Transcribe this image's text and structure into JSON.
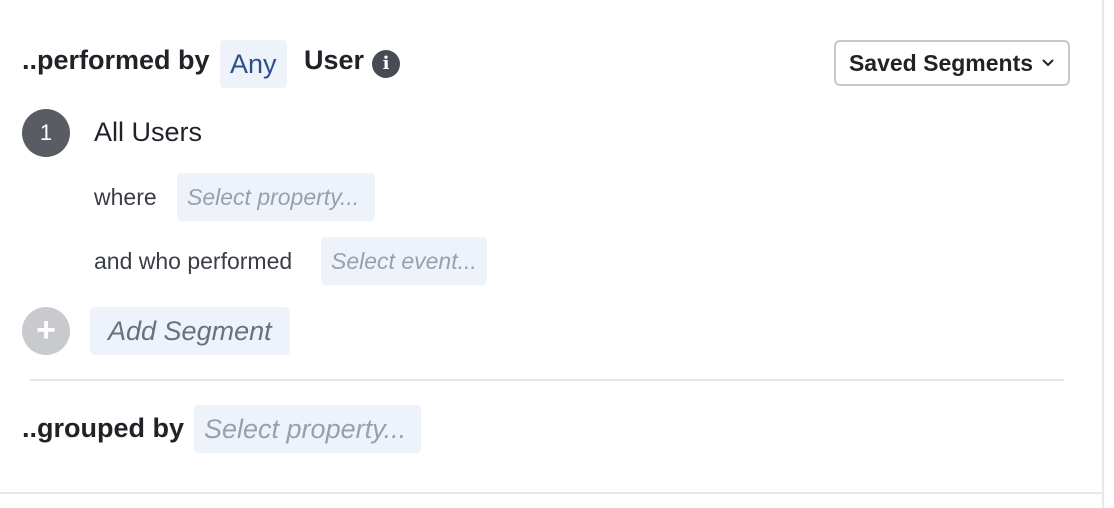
{
  "performed": {
    "label": "..performed by",
    "any_value": "Any",
    "user_label": "User",
    "info_icon": "info-icon",
    "info_glyph": "i"
  },
  "saved_segments": {
    "label": "Saved Segments",
    "icon": "chevron-down-icon"
  },
  "segment": {
    "number": "1",
    "name": "All Users",
    "where_label": "where",
    "property_placeholder": "Select property...",
    "performed_label": "and who performed",
    "event_placeholder": "Select event..."
  },
  "add_segment": {
    "icon": "plus-icon",
    "icon_glyph": "+",
    "label": "Add Segment"
  },
  "grouped": {
    "label": "..grouped by",
    "property_placeholder": "Select property..."
  },
  "colors": {
    "chip_bg": "#eef3fb",
    "any_text": "#2c4f8a",
    "number_circle": "#595c62",
    "plus_circle": "#c8cacd"
  }
}
